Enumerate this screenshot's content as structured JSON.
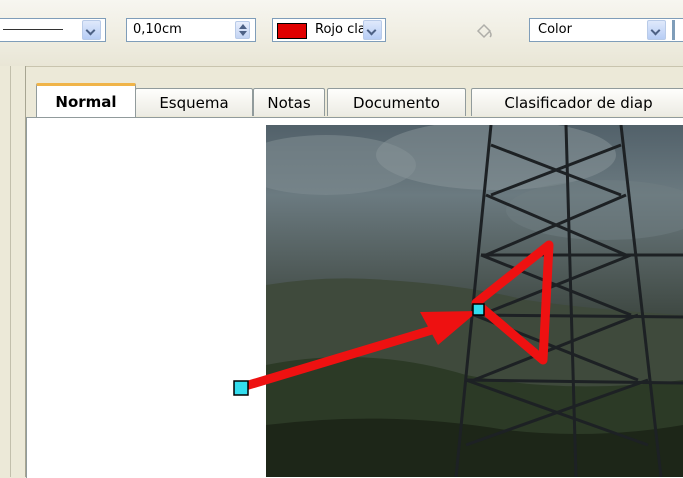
{
  "toolbar": {
    "line_width": "0,10cm",
    "line_color_label": "Rojo clar",
    "line_color_hex": "#e00000",
    "area_style": "Color",
    "icons": [
      "line-style-icon",
      "area-fill-bucket-icon"
    ]
  },
  "tabs": [
    {
      "label": "Normal",
      "active": true
    },
    {
      "label": "Esquema",
      "active": false
    },
    {
      "label": "Notas",
      "active": false
    },
    {
      "label": "Documento",
      "active": false
    },
    {
      "label": "Clasificador de diap",
      "active": false
    }
  ],
  "canvas": {
    "image": "photo-of-power-tower-landscape",
    "shapes": [
      {
        "type": "arrow",
        "color": "#ee1111",
        "selected": true
      },
      {
        "type": "triangle",
        "color": "#ee1111"
      }
    ]
  }
}
